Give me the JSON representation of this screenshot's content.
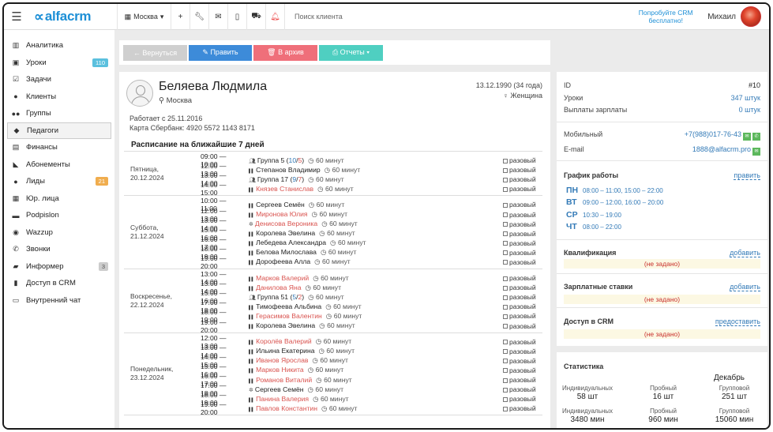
{
  "topbar": {
    "logo": "alfacrm",
    "city": "Москва",
    "search_placeholder": "Поиск клиента",
    "promo": "Попробуйте CRM бесплатно!",
    "user_name": "Михаил"
  },
  "sidebar": {
    "items": [
      {
        "label": "Аналитика",
        "icon": "columns-icon",
        "glyph": "▥"
      },
      {
        "label": "Уроки",
        "icon": "book-icon",
        "glyph": "▣",
        "badge": "110",
        "badge_color": "blue"
      },
      {
        "label": "Задачи",
        "icon": "tasks-icon",
        "glyph": "☑"
      },
      {
        "label": "Клиенты",
        "icon": "user-icon",
        "glyph": "●"
      },
      {
        "label": "Группы",
        "icon": "group-icon",
        "glyph": "●●"
      },
      {
        "label": "Педагоги",
        "icon": "graduation-cap-icon",
        "glyph": "◆",
        "active": true
      },
      {
        "label": "Финансы",
        "icon": "money-icon",
        "glyph": "▤"
      },
      {
        "label": "Абонементы",
        "icon": "tag-icon",
        "glyph": "◣"
      },
      {
        "label": "Лиды",
        "icon": "users-icon",
        "glyph": "●",
        "badge": "21",
        "badge_color": "orange"
      },
      {
        "label": "Юр. лица",
        "icon": "building-icon",
        "glyph": "▦"
      },
      {
        "label": "Podpislon",
        "icon": "document-icon",
        "glyph": "▬"
      },
      {
        "label": "Wazzup",
        "icon": "whatsapp-icon",
        "glyph": "◉"
      },
      {
        "label": "Звонки",
        "icon": "phone-icon",
        "glyph": "✆"
      },
      {
        "label": "Информер",
        "icon": "comment-icon",
        "glyph": "▰",
        "badge": "3",
        "badge_color": "gray"
      },
      {
        "label": "Доступ в CRM",
        "icon": "lock-icon",
        "glyph": "▮"
      },
      {
        "label": "Внутренний чат",
        "icon": "chat-icon",
        "glyph": "▭"
      }
    ]
  },
  "actions": {
    "back": "← Вернуться",
    "edit": "✎ Править",
    "archive": "🗑 В архив",
    "reports": "⎙ Отчеты ▾"
  },
  "profile": {
    "name": "Беляева Людмила",
    "city": "Москва",
    "birth": "13.12.1990 (34 года)",
    "gender": "Женщина",
    "works_since": "Работает с 25.11.2016",
    "card": "Карта Сбербанк: 4920 5572 1143 8171"
  },
  "schedule": {
    "title": "Расписание на ближайшие 7 дней",
    "duration_label": "60 минут",
    "once_label": "разовый",
    "days": [
      {
        "label": "Пятница,",
        "date": "20.12.2024",
        "lessons": [
          {
            "time": "09:00 — 10:00",
            "name": "Группа 5",
            "group": true,
            "cnt1": "10",
            "cnt2": "5",
            "red": false
          },
          {
            "time": "12:00 — 13:00",
            "name": "Степанов Владимир",
            "red": false
          },
          {
            "time": "13:00 — 14:00",
            "name": "Группа 17",
            "group": true,
            "cnt1": "9",
            "cnt2": "7",
            "red": false
          },
          {
            "time": "14:00 — 15:00",
            "name": "Князев Станислав",
            "red": true
          }
        ]
      },
      {
        "label": "Суббота,",
        "date": "21.12.2024",
        "lessons": [
          {
            "time": "10:00 — 11:00",
            "name": "Сергеев Семён",
            "red": false
          },
          {
            "time": "12:00 — 13:00",
            "name": "Миронова Юлия",
            "red": true
          },
          {
            "time": "13:00 — 14:00",
            "name": "Денисова Вероника",
            "red": true,
            "star": true
          },
          {
            "time": "15:00 — 16:00",
            "name": "Королева Эвелина",
            "red": false
          },
          {
            "time": "16:00 — 17:00",
            "name": "Лебедева Александра",
            "red": false
          },
          {
            "time": "18:00 — 19:00",
            "name": "Белова Милослава",
            "red": false
          },
          {
            "time": "19:00 — 20:00",
            "name": "Дорофеева Алла",
            "red": false
          }
        ]
      },
      {
        "label": "Воскресенье,",
        "date": "22.12.2024",
        "lessons": [
          {
            "time": "13:00 — 14:00",
            "name": "Марков Валерий",
            "red": true
          },
          {
            "time": "13:00 — 14:00",
            "name": "Данилова Яна",
            "red": true
          },
          {
            "time": "15:00 — 16:00",
            "name": "Группа 51",
            "group": true,
            "cnt1": "5",
            "cnt2": "2",
            "red": false
          },
          {
            "time": "17:00 — 18:00",
            "name": "Тимофеева Альбина",
            "red": false
          },
          {
            "time": "18:00 — 19:00",
            "name": "Герасимов Валентин",
            "red": true
          },
          {
            "time": "19:00 — 20:00",
            "name": "Королева Эвелина",
            "red": false
          }
        ]
      },
      {
        "label": "Понедельник,",
        "date": "23.12.2024",
        "lessons": [
          {
            "time": "12:00 — 13:00",
            "name": "Королёв Валерий",
            "red": true
          },
          {
            "time": "13:00 — 14:00",
            "name": "Ильина Екатерина",
            "red": false
          },
          {
            "time": "14:00 — 15:00",
            "name": "Иванов Ярослав",
            "red": true
          },
          {
            "time": "15:00 — 16:00",
            "name": "Марков Никита",
            "red": true
          },
          {
            "time": "16:00 — 17:00",
            "name": "Романов Виталий",
            "red": true
          },
          {
            "time": "17:00 — 18:00",
            "name": "Сергеев Семён",
            "red": false,
            "star": true
          },
          {
            "time": "18:00 — 19:00",
            "name": "Панина Валерия",
            "red": true
          },
          {
            "time": "19:00 — 20:00",
            "name": "Павлов Константин",
            "red": true
          }
        ]
      }
    ]
  },
  "info": {
    "id_label": "ID",
    "id_value": "#10",
    "lessons_label": "Уроки",
    "lessons_value": "347 штук",
    "payouts_label": "Выплаты зарплаты",
    "payouts_value": "0 штук",
    "mobile_label": "Мобильный",
    "mobile_value": "+7(988)017-76-43",
    "email_label": "E-mail",
    "email_value": "1888@alfacrm.pro",
    "schedule_title": "График работы",
    "schedule_action": "править",
    "workdays": [
      {
        "day": "ПН",
        "time": "08:00 – 11:00, 15:00 – 22:00"
      },
      {
        "day": "ВТ",
        "time": "09:00 – 12:00, 16:00 – 20:00"
      },
      {
        "day": "СР",
        "time": "10:30 – 19:00"
      },
      {
        "day": "ЧТ",
        "time": "08:00 – 22:00"
      }
    ],
    "qual_title": "Квалификация",
    "qual_action": "добавить",
    "qual_value": "(не задано)",
    "salary_title": "Зарплатные ставки",
    "salary_action": "добавить",
    "salary_value": "(не задано)",
    "access_title": "Доступ в CRM",
    "access_action": "предоставить",
    "access_value": "(не задано)"
  },
  "stats": {
    "title": "Статистика",
    "month": "Декабрь",
    "cells": [
      {
        "label": "Индивидуальных",
        "value": "58 шт"
      },
      {
        "label": "Пробный",
        "value": "16 шт"
      },
      {
        "label": "Групповой",
        "value": "251 шт"
      },
      {
        "label": "Индивидуальных",
        "value": "3480 мин"
      },
      {
        "label": "Пробный",
        "value": "960 мин"
      },
      {
        "label": "Групповой",
        "value": "15060 мин"
      }
    ]
  }
}
